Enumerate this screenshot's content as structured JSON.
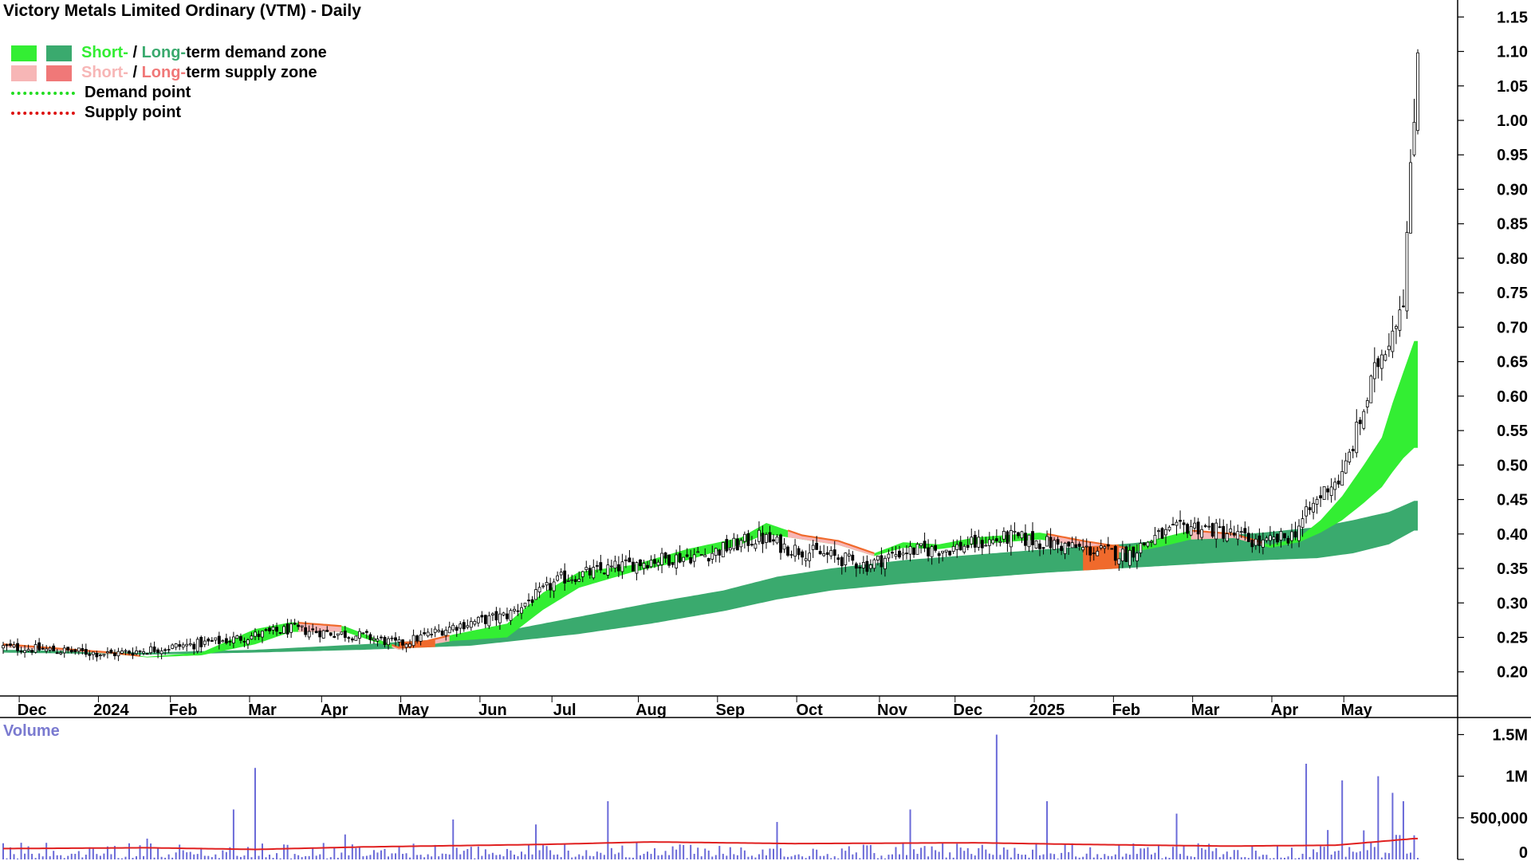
{
  "title": "Victory Metals Limited Ordinary (VTM) - Daily",
  "legend": {
    "demand_zone": {
      "short": "Short-",
      "sep": " / ",
      "long": "Long-",
      "rest": "term demand zone"
    },
    "supply_zone": {
      "short": "Short-",
      "sep": " / ",
      "long": "Long-",
      "rest": "term supply zone"
    },
    "demand_point": "Demand point",
    "supply_point": "Supply point"
  },
  "colors": {
    "short_demand": "#33ee33",
    "long_demand": "#3aaa6e",
    "short_supply": "#f7b6b6",
    "long_supply": "#f07878",
    "supply_overlap": "#f06a2c",
    "volume_bar": "#6a6ad8",
    "volume_ma": "#e02020",
    "demand_point": "#22dd22",
    "supply_point": "#dd1111"
  },
  "volume_label": "Volume",
  "chart_data": {
    "type": "candlestick",
    "title": "Victory Metals Limited Ordinary (VTM) - Daily",
    "price_axis": {
      "ylim": [
        0.165,
        1.17
      ],
      "ticks": [
        "0.20",
        "0.25",
        "0.30",
        "0.35",
        "0.40",
        "0.45",
        "0.50",
        "0.55",
        "0.60",
        "0.65",
        "0.70",
        "0.75",
        "0.80",
        "0.85",
        "0.90",
        "0.95",
        "1.00",
        "1.05",
        "1.10",
        "1.15"
      ]
    },
    "volume_axis": {
      "ylim": [
        0,
        1600000
      ],
      "ticks": [
        {
          "v": 0,
          "label": "0"
        },
        {
          "v": 500000,
          "label": "500,000"
        },
        {
          "v": 1000000,
          "label": "1M"
        },
        {
          "v": 1500000,
          "label": "1.5M"
        }
      ]
    },
    "x_axis": {
      "labels": [
        "Dec",
        "2024",
        "Feb",
        "Mar",
        "Apr",
        "May",
        "Jun",
        "Jul",
        "Aug",
        "Sep",
        "Oct",
        "Nov",
        "Dec",
        "2025",
        "Feb",
        "Mar",
        "Apr",
        "May"
      ],
      "bold": [
        "2024",
        "2025"
      ],
      "label_index": [
        8,
        30,
        50,
        72,
        92,
        114,
        136,
        156,
        180,
        202,
        224,
        247,
        268,
        290,
        312,
        334,
        356,
        376
      ]
    },
    "trend_anchors": [
      [
        0,
        0.236
      ],
      [
        30,
        0.226
      ],
      [
        60,
        0.244
      ],
      [
        80,
        0.262
      ],
      [
        100,
        0.252
      ],
      [
        110,
        0.24
      ],
      [
        125,
        0.266
      ],
      [
        140,
        0.282
      ],
      [
        155,
        0.335
      ],
      [
        168,
        0.349
      ],
      [
        180,
        0.362
      ],
      [
        195,
        0.37
      ],
      [
        210,
        0.395
      ],
      [
        218,
        0.38
      ],
      [
        228,
        0.37
      ],
      [
        240,
        0.355
      ],
      [
        250,
        0.375
      ],
      [
        262,
        0.378
      ],
      [
        280,
        0.395
      ],
      [
        292,
        0.385
      ],
      [
        300,
        0.378
      ],
      [
        312,
        0.37
      ],
      [
        320,
        0.395
      ],
      [
        330,
        0.412
      ],
      [
        340,
        0.402
      ],
      [
        350,
        0.385
      ],
      [
        358,
        0.398
      ],
      [
        368,
        0.47
      ],
      [
        372,
        0.482
      ],
      [
        378,
        0.58
      ],
      [
        382,
        0.65
      ],
      [
        386,
        0.7
      ],
      [
        389,
        0.75
      ],
      [
        392,
        1.0
      ],
      [
        393,
        1.12
      ]
    ],
    "bands": {
      "short_upper": [
        [
          0,
          0.24
        ],
        [
          30,
          0.228
        ],
        [
          40,
          0.222
        ],
        [
          55,
          0.228
        ],
        [
          70,
          0.262
        ],
        [
          80,
          0.272
        ],
        [
          95,
          0.266
        ],
        [
          110,
          0.235
        ],
        [
          125,
          0.254
        ],
        [
          140,
          0.27
        ],
        [
          150,
          0.315
        ],
        [
          160,
          0.345
        ],
        [
          175,
          0.355
        ],
        [
          190,
          0.378
        ],
        [
          205,
          0.395
        ],
        [
          212,
          0.416
        ],
        [
          222,
          0.398
        ],
        [
          232,
          0.39
        ],
        [
          242,
          0.372
        ],
        [
          250,
          0.388
        ],
        [
          260,
          0.385
        ],
        [
          270,
          0.395
        ],
        [
          288,
          0.402
        ],
        [
          300,
          0.39
        ],
        [
          312,
          0.38
        ],
        [
          322,
          0.395
        ],
        [
          330,
          0.405
        ],
        [
          342,
          0.4
        ],
        [
          352,
          0.384
        ],
        [
          360,
          0.395
        ],
        [
          366,
          0.42
        ],
        [
          372,
          0.455
        ],
        [
          378,
          0.5
        ],
        [
          383,
          0.54
        ],
        [
          386,
          0.59
        ],
        [
          389,
          0.635
        ],
        [
          392,
          0.68
        ]
      ],
      "short_lower": [
        [
          0,
          0.236
        ],
        [
          30,
          0.226
        ],
        [
          40,
          0.221
        ],
        [
          55,
          0.224
        ],
        [
          70,
          0.24
        ],
        [
          80,
          0.258
        ],
        [
          95,
          0.258
        ],
        [
          110,
          0.232
        ],
        [
          125,
          0.245
        ],
        [
          140,
          0.25
        ],
        [
          150,
          0.29
        ],
        [
          160,
          0.322
        ],
        [
          175,
          0.345
        ],
        [
          190,
          0.362
        ],
        [
          205,
          0.385
        ],
        [
          212,
          0.4
        ],
        [
          222,
          0.392
        ],
        [
          232,
          0.384
        ],
        [
          242,
          0.368
        ],
        [
          250,
          0.38
        ],
        [
          260,
          0.378
        ],
        [
          270,
          0.385
        ],
        [
          288,
          0.392
        ],
        [
          300,
          0.382
        ],
        [
          312,
          0.372
        ],
        [
          322,
          0.382
        ],
        [
          330,
          0.392
        ],
        [
          342,
          0.394
        ],
        [
          352,
          0.38
        ],
        [
          360,
          0.388
        ],
        [
          366,
          0.402
        ],
        [
          372,
          0.42
        ],
        [
          378,
          0.445
        ],
        [
          383,
          0.468
        ],
        [
          386,
          0.49
        ],
        [
          389,
          0.51
        ],
        [
          392,
          0.525
        ]
      ],
      "long_upper": [
        [
          0,
          0.232
        ],
        [
          40,
          0.228
        ],
        [
          70,
          0.232
        ],
        [
          100,
          0.24
        ],
        [
          130,
          0.25
        ],
        [
          160,
          0.28
        ],
        [
          180,
          0.3
        ],
        [
          200,
          0.318
        ],
        [
          215,
          0.338
        ],
        [
          230,
          0.35
        ],
        [
          250,
          0.362
        ],
        [
          270,
          0.37
        ],
        [
          290,
          0.378
        ],
        [
          310,
          0.385
        ],
        [
          330,
          0.394
        ],
        [
          350,
          0.402
        ],
        [
          365,
          0.41
        ],
        [
          375,
          0.42
        ],
        [
          385,
          0.432
        ],
        [
          392,
          0.448
        ]
      ],
      "long_lower": [
        [
          0,
          0.228
        ],
        [
          40,
          0.225
        ],
        [
          70,
          0.228
        ],
        [
          100,
          0.232
        ],
        [
          130,
          0.238
        ],
        [
          160,
          0.255
        ],
        [
          180,
          0.27
        ],
        [
          200,
          0.288
        ],
        [
          215,
          0.305
        ],
        [
          230,
          0.318
        ],
        [
          250,
          0.328
        ],
        [
          270,
          0.336
        ],
        [
          290,
          0.344
        ],
        [
          310,
          0.35
        ],
        [
          330,
          0.356
        ],
        [
          350,
          0.362
        ],
        [
          365,
          0.365
        ],
        [
          375,
          0.372
        ],
        [
          385,
          0.385
        ],
        [
          392,
          0.405
        ]
      ],
      "supply_segments": [
        [
          0,
          38
        ],
        [
          82,
          94
        ],
        [
          108,
          124
        ],
        [
          218,
          242
        ],
        [
          290,
          312
        ],
        [
          330,
          350
        ]
      ],
      "supply_thick": [
        [
          110,
          120
        ],
        [
          300,
          310
        ]
      ]
    },
    "volume_spikes": [
      [
        5,
        200000
      ],
      [
        40,
        250000
      ],
      [
        64,
        600000
      ],
      [
        70,
        1100000
      ],
      [
        95,
        300000
      ],
      [
        125,
        480000
      ],
      [
        148,
        420000
      ],
      [
        168,
        700000
      ],
      [
        215,
        450000
      ],
      [
        252,
        600000
      ],
      [
        276,
        1500000
      ],
      [
        290,
        700000
      ],
      [
        326,
        550000
      ],
      [
        362,
        1150000
      ],
      [
        372,
        950000
      ],
      [
        382,
        1000000
      ],
      [
        386,
        800000
      ],
      [
        389,
        700000
      ]
    ],
    "volume_ma": [
      [
        0,
        130000
      ],
      [
        40,
        140000
      ],
      [
        70,
        120000
      ],
      [
        100,
        150000
      ],
      [
        150,
        180000
      ],
      [
        180,
        210000
      ],
      [
        220,
        190000
      ],
      [
        270,
        200000
      ],
      [
        300,
        180000
      ],
      [
        340,
        160000
      ],
      [
        370,
        170000
      ],
      [
        392,
        250000
      ]
    ]
  }
}
